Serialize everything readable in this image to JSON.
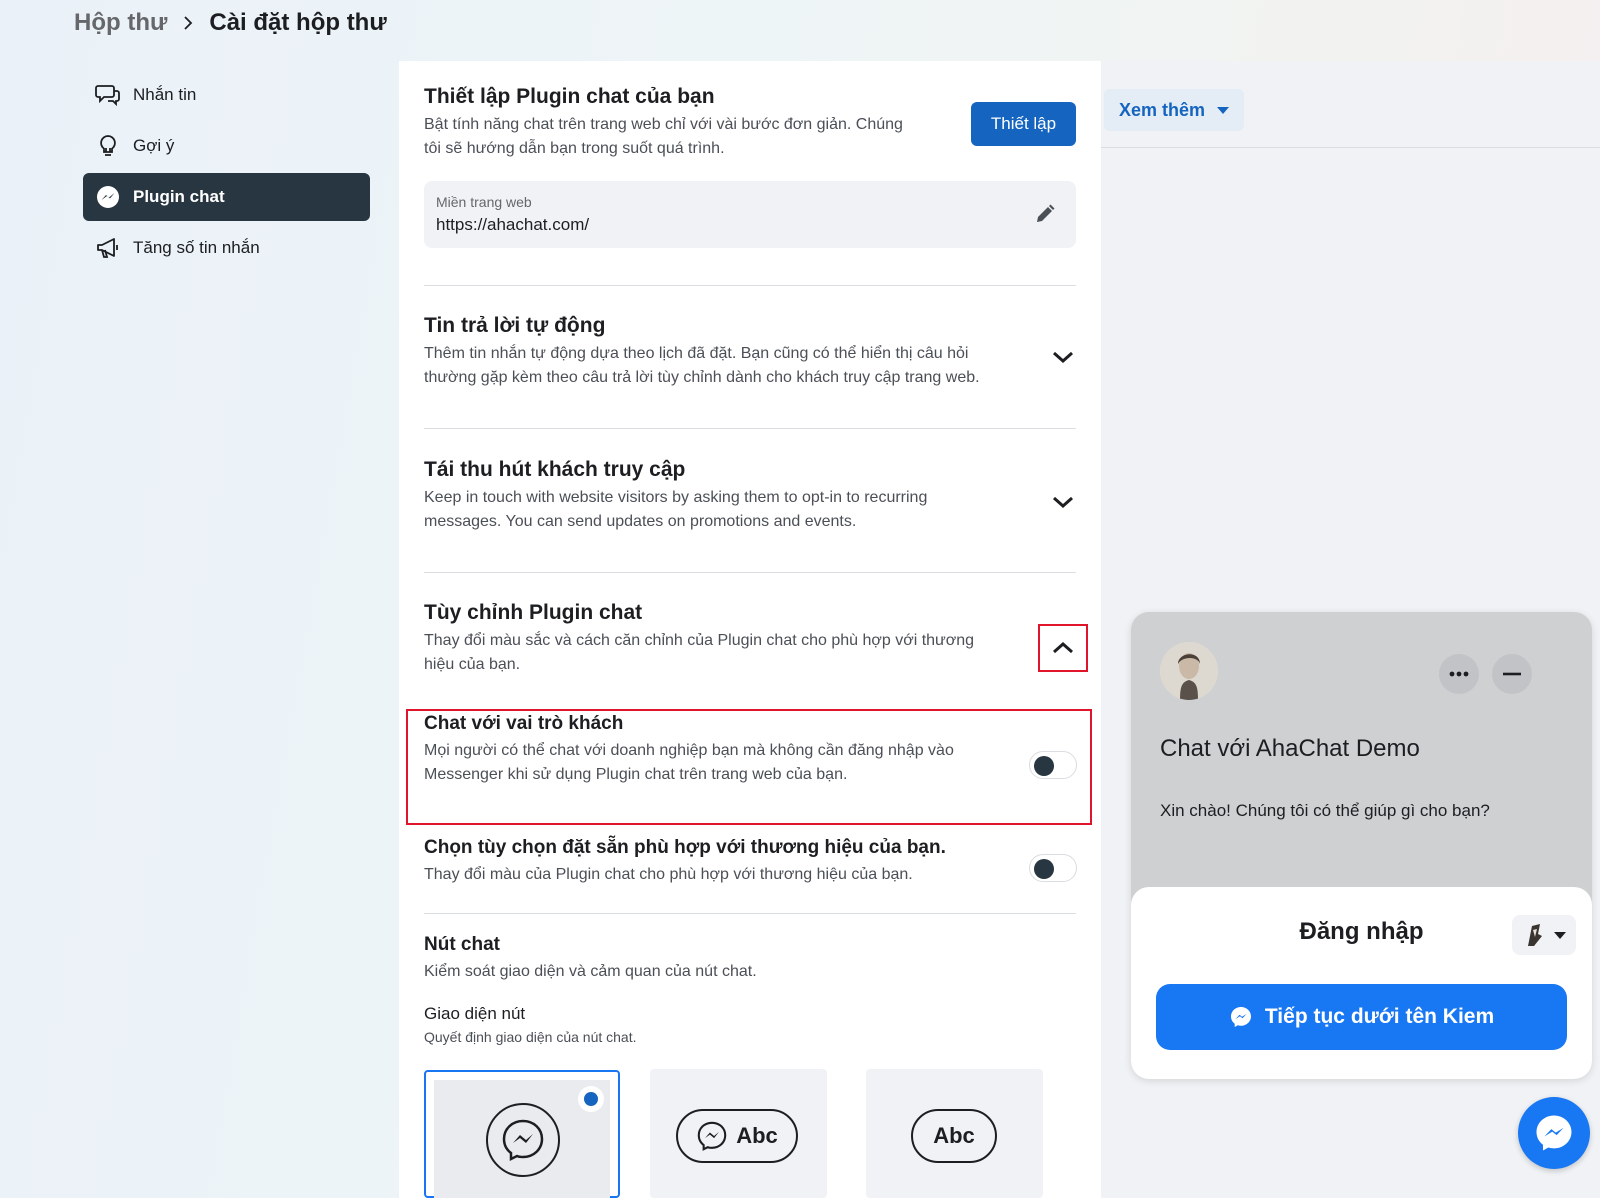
{
  "breadcrumb": {
    "root": "Hộp thư",
    "current": "Cài đặt hộp thư"
  },
  "sidebar": {
    "items": [
      {
        "label": "Nhắn tin",
        "icon": "chat-bubbles-icon"
      },
      {
        "label": "Gợi ý",
        "icon": "lightbulb-icon"
      },
      {
        "label": "Plugin chat",
        "icon": "messenger-icon",
        "active": true
      },
      {
        "label": "Tăng số tin nhắn",
        "icon": "megaphone-icon"
      }
    ]
  },
  "setup": {
    "title": "Thiết lập Plugin chat của bạn",
    "desc_line1": "Bật tính năng chat trên trang web chỉ với vài bước đơn giản. Chúng",
    "desc_line2": "tôi sẽ hướng dẫn bạn trong suốt quá trình.",
    "button": "Thiết lập",
    "domain_label": "Miền trang web",
    "domain_value": "https://ahachat.com/"
  },
  "auto_reply": {
    "title": "Tin trả lời tự động",
    "desc_line1": "Thêm tin nhắn tự động dựa theo lịch đã đặt. Bạn cũng có thể hiển thị câu hỏi",
    "desc_line2": "thường gặp kèm theo câu trả lời tùy chỉnh dành cho khách truy cập trang web."
  },
  "reengage": {
    "title": "Tái thu hút khách truy cập",
    "desc_line1": "Keep in touch with website visitors by asking them to opt-in to recurring",
    "desc_line2": "messages. You can send updates on promotions and events."
  },
  "customize": {
    "title": "Tùy chỉnh Plugin chat",
    "desc_line1": "Thay đổi màu sắc và cách căn chỉnh của Plugin chat cho phù hợp với thương",
    "desc_line2": "hiệu của bạn."
  },
  "guest_chat": {
    "title": "Chat với vai trò khách",
    "desc_line1": "Mọi người có thể chat với doanh nghiệp bạn mà không cần đăng nhập vào",
    "desc_line2": "Messenger khi sử dụng Plugin chat trên trang web của bạn.",
    "enabled": false
  },
  "brand_preset": {
    "title": "Chọn tùy chọn đặt sẵn phù hợp với thương hiệu của bạn.",
    "desc": "Thay đổi màu của Plugin chat cho phù hợp với thương hiệu của bạn.",
    "enabled": false
  },
  "chat_button": {
    "title": "Nút chat",
    "desc": "Kiểm soát giao diện và cảm quan của nút chat.",
    "appearance_title": "Giao diện nút",
    "appearance_desc": "Quyết định giao diện của nút chat.",
    "option_2_label": "Abc",
    "option_3_label": "Abc",
    "selected_option": 1
  },
  "right": {
    "more_label": "Xem thêm"
  },
  "preview": {
    "title": "Chat với AhaChat Demo",
    "greeting": "Xin chào! Chúng tôi có thể giúp gì cho bạn?",
    "login_title": "Đăng nhập",
    "continue_label": "Tiếp tục dưới tên Kiem"
  },
  "colors": {
    "accent": "#1565c0",
    "messenger_blue": "#1877f2",
    "active_nav": "#283641",
    "highlight_red": "#e0142a"
  }
}
